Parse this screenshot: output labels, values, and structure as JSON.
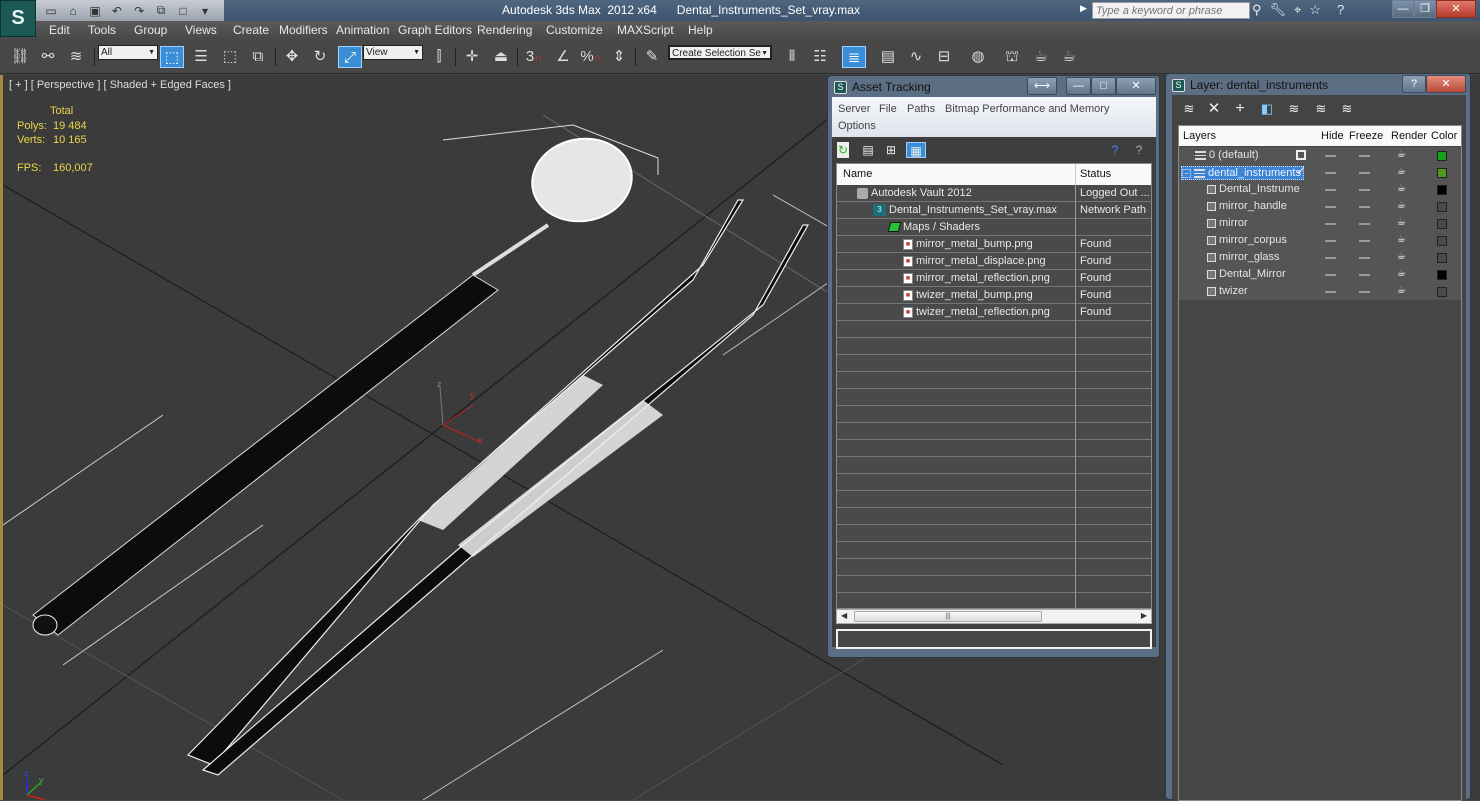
{
  "app": {
    "title": "Autodesk 3ds Max  2012 x64",
    "file_name": "Dental_Instruments_Set_vray.max",
    "logo_icon": "3ds-max-logo-icon",
    "search_placeholder": "Type a keyword or phrase"
  },
  "quick_access": [
    "new-icon",
    "open-icon",
    "save-icon",
    "undo-icon",
    "redo-icon",
    "project-folder-icon",
    "window-icon",
    "overflow-icon"
  ],
  "menu": [
    "Edit",
    "Tools",
    "Group",
    "Views",
    "Create",
    "Modifiers",
    "Animation",
    "Graph Editors",
    "Rendering",
    "Customize",
    "MAXScript",
    "Help"
  ],
  "toolbar": {
    "selection_filter": "All",
    "reference_coord": "View",
    "named_selection": "Create Selection Se",
    "snap_label": "3",
    "percent_label": "%"
  },
  "viewport": {
    "label": "[ + ] [ Perspective ] [ Shaded + Edged Faces ]",
    "stats_header": "Total",
    "polys_label": "Polys:",
    "polys_value": "19 484",
    "verts_label": "Verts:",
    "verts_value": "10 165",
    "fps_label": "FPS:",
    "fps_value": "160,007",
    "axes": {
      "x": "x",
      "y": "y",
      "z": "z"
    },
    "border_color": "#a68a3e",
    "stats_color": "#e9d54a"
  },
  "asset_tracking": {
    "title": "Asset Tracking",
    "menu": [
      "Server",
      "File",
      "Paths",
      "Bitmap Performance and Memory",
      "Options"
    ],
    "columns": [
      "Name",
      "Status"
    ],
    "rows": [
      {
        "name": "Autodesk Vault 2012",
        "status": "Logged Out ...",
        "icon": "vault",
        "level": 1
      },
      {
        "name": "Dental_Instruments_Set_vray.max",
        "status": "Network Path",
        "icon": "max",
        "level": 2
      },
      {
        "name": "Maps / Shaders",
        "status": "",
        "icon": "maps",
        "level": 3
      },
      {
        "name": "mirror_metal_bump.png",
        "status": "Found",
        "icon": "file",
        "level": 4
      },
      {
        "name": "mirror_metal_displace.png",
        "status": "Found",
        "icon": "file",
        "level": 4
      },
      {
        "name": "mirror_metal_reflection.png",
        "status": "Found",
        "icon": "file",
        "level": 4
      },
      {
        "name": "twizer_metal_bump.png",
        "status": "Found",
        "icon": "file",
        "level": 4
      },
      {
        "name": "twizer_metal_reflection.png",
        "status": "Found",
        "icon": "file",
        "level": 4
      }
    ]
  },
  "layer_manager": {
    "title": "Layer: dental_instruments",
    "columns": [
      "Layers",
      "Hide",
      "Freeze",
      "Render",
      "Color"
    ],
    "rows": [
      {
        "name": "0 (default)",
        "type": "layer",
        "current": "box",
        "color": "#1aa01a",
        "level": 0
      },
      {
        "name": "dental_instruments",
        "type": "layer",
        "current": "check",
        "color": "#4f9a1c",
        "level": 0,
        "selected": true,
        "expanded": true
      },
      {
        "name": "Dental_Instrume",
        "type": "object",
        "color": "#000000",
        "level": 1
      },
      {
        "name": "mirror_handle",
        "type": "object",
        "color": "#4a4a4a",
        "level": 1
      },
      {
        "name": "mirror",
        "type": "object",
        "color": "#4a4a4a",
        "level": 1
      },
      {
        "name": "mirror_corpus",
        "type": "object",
        "color": "#4a4a4a",
        "level": 1
      },
      {
        "name": "mirror_glass",
        "type": "object",
        "color": "#4a4a4a",
        "level": 1
      },
      {
        "name": "Dental_Mirror",
        "type": "object",
        "color": "#000000",
        "level": 1
      },
      {
        "name": "twizer",
        "type": "object",
        "color": "#4a4a4a",
        "level": 1
      }
    ]
  }
}
